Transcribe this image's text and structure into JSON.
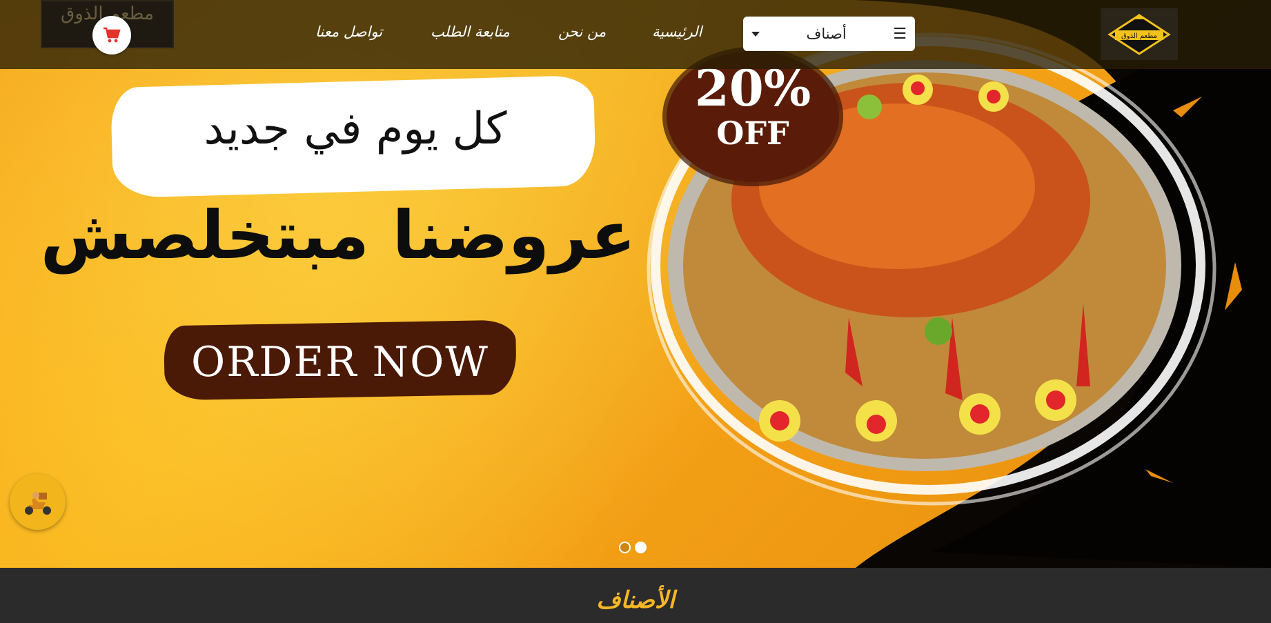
{
  "header": {
    "logo_left_text": "مطعم الذوق",
    "logo_right_text": "مطعم الذوق",
    "category_select": {
      "label": "أصناف",
      "menu_icon": "hamburger-icon",
      "caret_icon": "caret-down-icon"
    },
    "nav": [
      {
        "label": "الرئيسية"
      },
      {
        "label": "من نحن"
      },
      {
        "label": "متابعة الطلب"
      },
      {
        "label": "تواصل معنا"
      }
    ],
    "cart_icon": "cart-icon",
    "cart_color": "#e5332a"
  },
  "banner": {
    "slogan": "كل يوم في جديد",
    "headline": "عروضنا مبتخلصش",
    "cta": "ORDER NOW",
    "offer_percent": "20%",
    "offer_label": "OFF",
    "slide_count": 2,
    "active_slide": 2
  },
  "floating": {
    "delivery_icon": "delivery-scooter-icon"
  },
  "section": {
    "title": "الأصناف"
  },
  "colors": {
    "accent": "#f6b626",
    "brand_brown": "#4a1a06",
    "header_bg": "#2b2b2b"
  }
}
